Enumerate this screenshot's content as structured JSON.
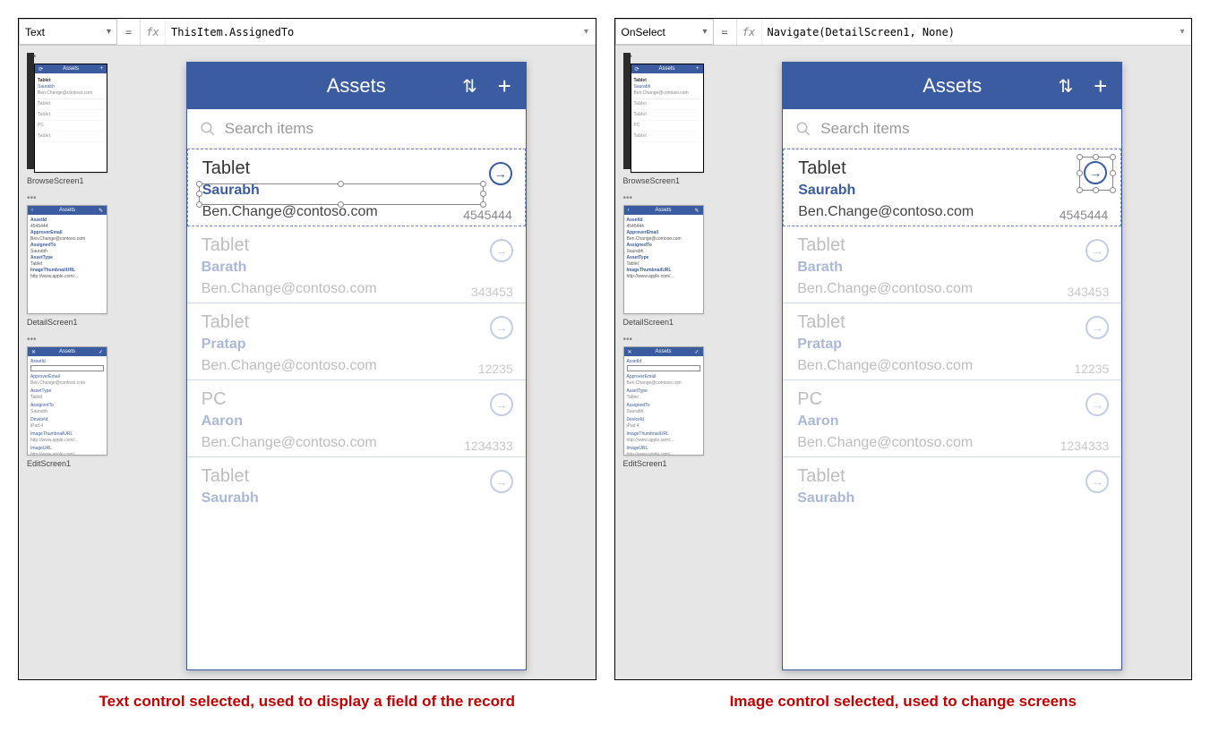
{
  "left": {
    "property": "Text",
    "formula": "ThisItem.AssignedTo",
    "caption": "Text control selected, used to display a field of the record"
  },
  "right": {
    "property": "OnSelect",
    "formula": "Navigate(DetailScreen1, None)",
    "caption": "Image control selected, used to change screens"
  },
  "fx_label": "fx",
  "equals": "=",
  "screens": {
    "browse": "BrowseScreen1",
    "detail": "DetailScreen1",
    "edit": "EditScreen1",
    "header": "Assets"
  },
  "phone": {
    "title": "Assets",
    "search_placeholder": "Search items",
    "items": [
      {
        "title": "Tablet",
        "assignee": "Saurabh",
        "email": "Ben.Change@contoso.com",
        "num": "4545444"
      },
      {
        "title": "Tablet",
        "assignee": "Barath",
        "email": "Ben.Change@contoso.com",
        "num": "343453"
      },
      {
        "title": "Tablet",
        "assignee": "Pratap",
        "email": "Ben.Change@contoso.com",
        "num": "12235"
      },
      {
        "title": "PC",
        "assignee": "Aaron",
        "email": "Ben.Change@contoso.com",
        "num": "1234333"
      },
      {
        "title": "Tablet",
        "assignee": "Saurabh",
        "email": "",
        "num": ""
      }
    ]
  }
}
